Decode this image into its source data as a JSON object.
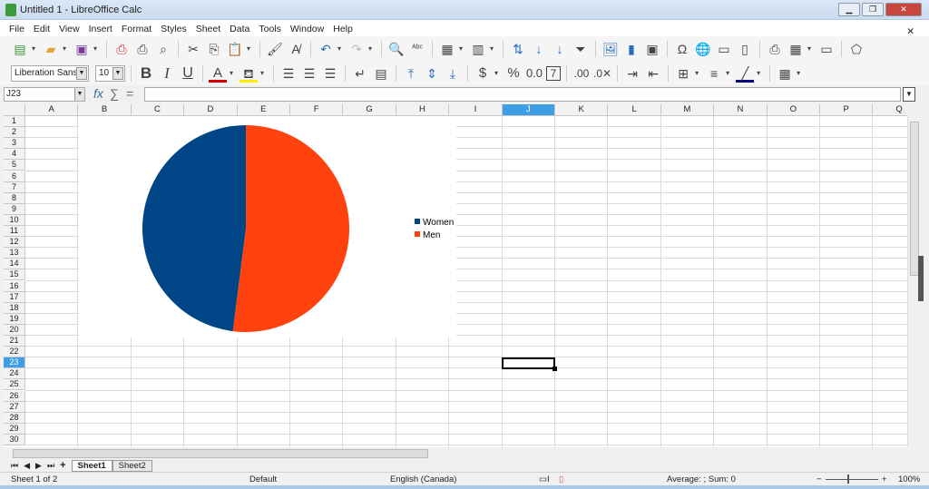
{
  "window": {
    "title": "Untitled 1 - LibreOffice Calc"
  },
  "menu": [
    "File",
    "Edit",
    "View",
    "Insert",
    "Format",
    "Styles",
    "Sheet",
    "Data",
    "Tools",
    "Window",
    "Help"
  ],
  "format_toolbar": {
    "font_name": "Liberation Sans",
    "font_size": "10",
    "font_color": "#cc0000",
    "highlight_color": "#ffee00"
  },
  "formula_bar": {
    "name_box": "J23",
    "value": ""
  },
  "columns": [
    "A",
    "B",
    "C",
    "D",
    "E",
    "F",
    "G",
    "H",
    "I",
    "J",
    "K",
    "L",
    "M",
    "N",
    "O",
    "P",
    "Q"
  ],
  "rows": [
    "1",
    "2",
    "3",
    "4",
    "5",
    "6",
    "7",
    "8",
    "9",
    "10",
    "11",
    "12",
    "13",
    "14",
    "15",
    "16",
    "17",
    "18",
    "19",
    "20",
    "21",
    "22",
    "23",
    "24",
    "25",
    "26",
    "27",
    "28",
    "29",
    "30"
  ],
  "selected_cell": {
    "column": "J",
    "row": "23"
  },
  "chart_data": {
    "type": "pie",
    "categories": [
      "Women",
      "Men"
    ],
    "values": [
      48,
      52
    ],
    "colors": [
      "#004586",
      "#ff420e"
    ],
    "legend": "right"
  },
  "sheet_tabs": [
    "Sheet1",
    "Sheet2"
  ],
  "active_sheet": "Sheet1",
  "status": {
    "sheet": "Sheet 1 of 2",
    "page_style": "Default",
    "language": "English (Canada)",
    "summary": "Average: ; Sum: 0",
    "zoom": "100%"
  }
}
